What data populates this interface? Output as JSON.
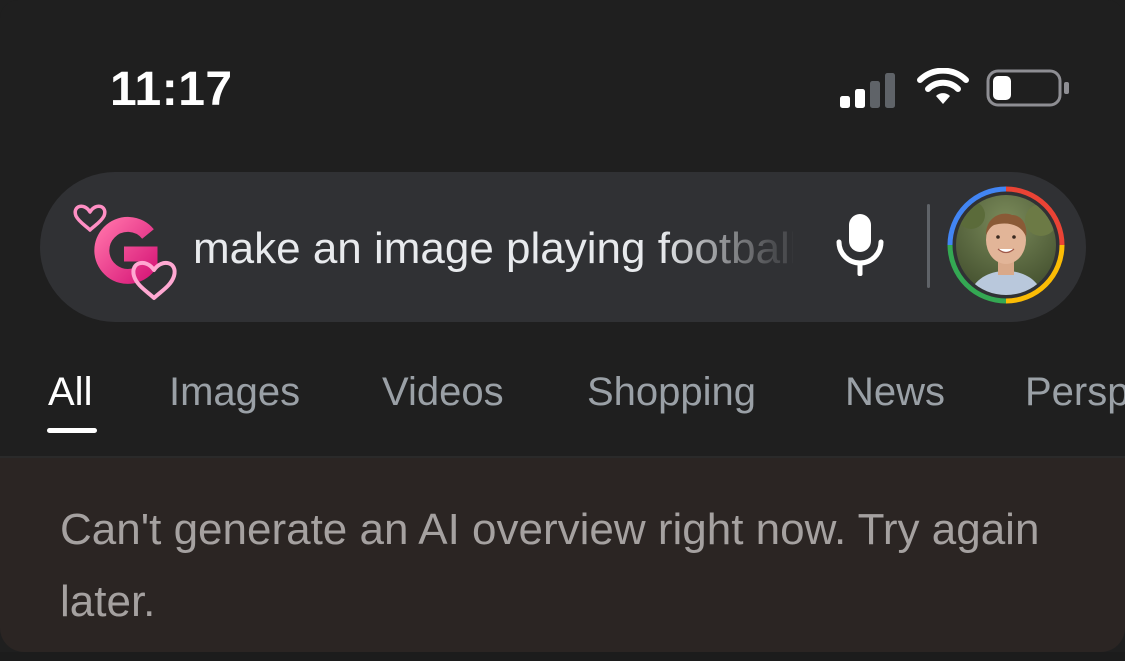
{
  "status_bar": {
    "time": "11:17",
    "signal_icon": "cellular-signal-icon",
    "wifi_icon": "wifi-icon",
    "battery_icon": "battery-low-icon",
    "battery_level": 0.2
  },
  "search": {
    "logo_icon": "google-g-hearts-icon",
    "query": "make an image playing football",
    "mic_icon": "microphone-icon",
    "avatar": "profile-avatar"
  },
  "tabs": [
    {
      "label": "All",
      "active": true
    },
    {
      "label": "Images",
      "active": false
    },
    {
      "label": "Videos",
      "active": false
    },
    {
      "label": "Shopping",
      "active": false
    },
    {
      "label": "News",
      "active": false
    },
    {
      "label": "Perspectives",
      "active": false
    }
  ],
  "overview": {
    "message": "Can't generate an AI overview right now. Try again later."
  },
  "colors": {
    "background": "#1f1f1f",
    "search_bar": "#303134",
    "overview_bg": "#2b2523",
    "active_tab": "#ffffff",
    "inactive_tab": "#9aa0a6",
    "google_blue": "#4285f4",
    "google_red": "#ea4335",
    "google_yellow": "#fbbc05",
    "google_green": "#34a853"
  }
}
